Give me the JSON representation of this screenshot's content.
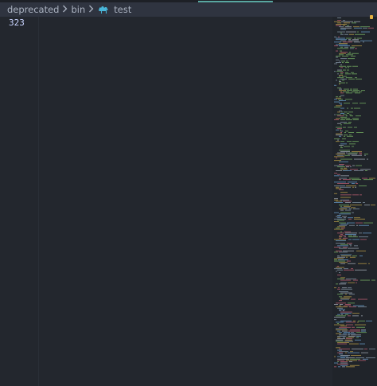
{
  "breadcrumb": {
    "items": [
      "deprecated",
      "bin",
      "test"
    ],
    "file_icon": "camel-icon"
  },
  "editor": {
    "line_number": "323",
    "current_line_text": ""
  },
  "minimap": {
    "icon": "minimap",
    "line_colors": [
      "#7fbf6a",
      "#c8a84b",
      "#8fa1b3",
      "#6fa8dc",
      "#cf6679",
      "#b0b8c4"
    ]
  },
  "scrollbar": {
    "marker_color": "#e4b040"
  },
  "top_bar": {
    "accent": "#58a6a0"
  }
}
